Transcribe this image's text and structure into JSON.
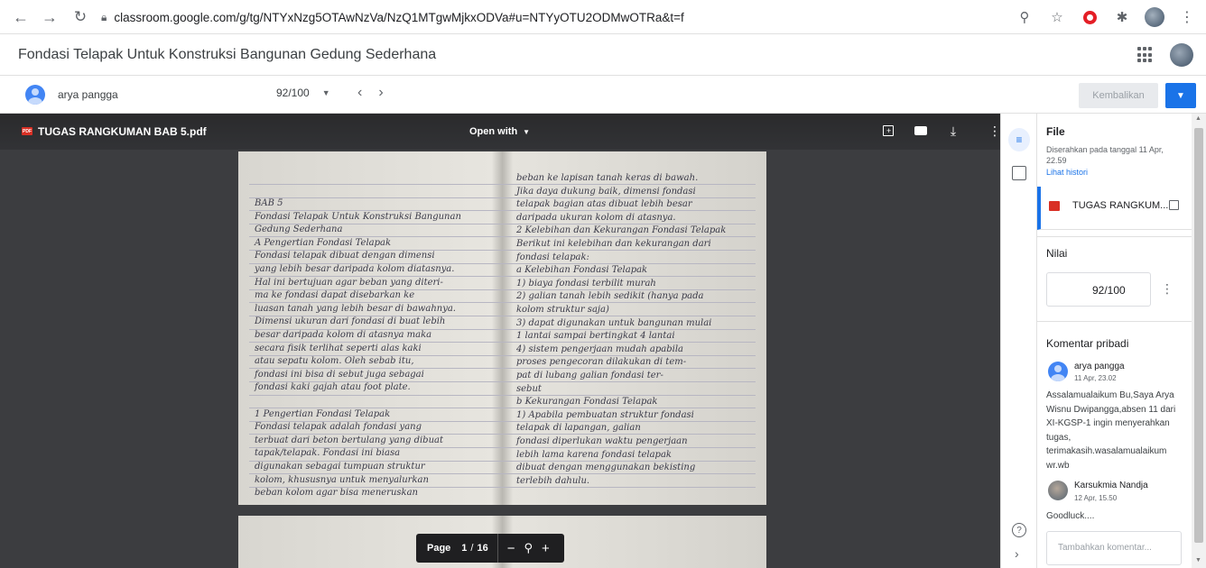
{
  "browser": {
    "url": "classroom.google.com/g/tg/NTYxNzg5OTAwNzVa/NzQ1MTgwMjkxODVa#u=NTYyOTU2ODMwOTRa&t=f"
  },
  "header": {
    "title": "Fondasi Telapak Untuk Konstruksi Bangunan Gedung Sederhana"
  },
  "student_bar": {
    "student_name": "arya pangga",
    "grade": "92/100",
    "return_label": "Kembalikan"
  },
  "viewer": {
    "file_name": "TUGAS RANGKUMAN BAB 5.pdf",
    "pdf_badge": "PDF",
    "open_with": "Open with",
    "pager": {
      "label": "Page",
      "current": "1",
      "sep": "/",
      "total": "16"
    }
  },
  "notebook": {
    "left_lines": [
      "BAB 5",
      "Fondasi Telapak Untuk Konstruksi Bangunan",
      "Gedung Sederhana",
      "A   Pengertian Fondasi Telapak",
      "Fondasi telapak dibuat dengan dimensi",
      "yang lebih besar daripada kolom diatasnya.",
      "Hal ini bertujuan agar beban yang diteri-",
      "ma ke fondasi dapat disebarkan ke",
      "luasan tanah yang lebih besar di bawahnya.",
      "Dimensi ukuran dari fondasi di buat lebih",
      "besar daripada kolom di atasnya maka",
      "secara fisik terlihat seperti alas kaki",
      "atau sepatu kolom. Oleh sebab itu,",
      "fondasi ini bisa di sebut juga sebagai",
      "fondasi kaki gajah atau foot plate.",
      "",
      "1  Pengertian Fondasi Telapak",
      "Fondasi telapak adalah fondasi yang",
      "terbuat dari beton bertulang yang dibuat",
      "tapak/telapak. Fondasi ini biasa",
      "digunakan sebagai tumpuan struktur",
      "kolom, khususnya untuk menyalurkan",
      "beban kolom agar bisa meneruskan"
    ],
    "right_lines": [
      "beban ke lapisan tanah keras di bawah.",
      "Jika daya dukung baik, dimensi fondasi",
      "telapak bagian atas dibuat lebih besar",
      "daripada ukuran kolom di atasnya.",
      "2  Kelebihan dan Kekurangan Fondasi Telapak",
      "Berikut ini kelebihan dan kekurangan dari",
      "fondasi telapak:",
      "a  Kelebihan Fondasi Telapak",
      "1)  biaya fondasi terbilit murah",
      "2)  galian tanah lebih sedikit (hanya pada",
      "     kolom struktur saja)",
      "3)  dapat digunakan untuk bangunan mulai",
      "     1 lantai sampai bertingkat 4 lantai",
      "4)  sistem pengerjaan mudah apabila",
      "     proses pengecoran dilakukan di tem-",
      "     pat di lubang galian fondasi ter-",
      "     sebut",
      "b  Kekurangan Fondasi Telapak",
      "1)  Apabila pembuatan struktur fondasi",
      "     telapak di lapangan, galian",
      "     fondasi diperlukan waktu pengerjaan",
      "     lebih lama karena fondasi telapak",
      "     dibuat dengan menggunakan bekisting",
      "     terlebih dahulu."
    ]
  },
  "panel": {
    "file_heading": "File",
    "submitted_text": "Diserahkan pada tanggal 11 Apr, 22.59",
    "history_link": "Lihat histori",
    "file_attachment": "TUGAS RANGKUM...",
    "grade_heading": "Nilai",
    "grade_value": "92/100",
    "comments_heading": "Komentar pribadi",
    "comments": [
      {
        "author": "arya pangga",
        "time": "11 Apr, 23.02",
        "text": "Assalamualaikum Bu,Saya Arya Wisnu Dwipangga,absen 11 dari XI-KGSP-1 ingin menyerahkan tugas, terimakasih.wasalamualaikum wr.wb"
      },
      {
        "author": "Karsukmia Nandja",
        "time": "12 Apr, 15.50",
        "text": "Goodluck...."
      }
    ],
    "add_comment_placeholder": "Tambahkan komentar..."
  },
  "icons": {
    "browser": [
      "back-icon",
      "forward-icon",
      "reload-icon",
      "lock-icon",
      "zoom-icon",
      "star-icon",
      "opera-icon",
      "extension-icon",
      "profile-avatar",
      "menu-icon"
    ],
    "viewer": [
      "add-comment-icon",
      "print-icon",
      "download-icon",
      "more-icon",
      "zoom-out-icon",
      "zoom-icon",
      "zoom-in-icon"
    ]
  }
}
